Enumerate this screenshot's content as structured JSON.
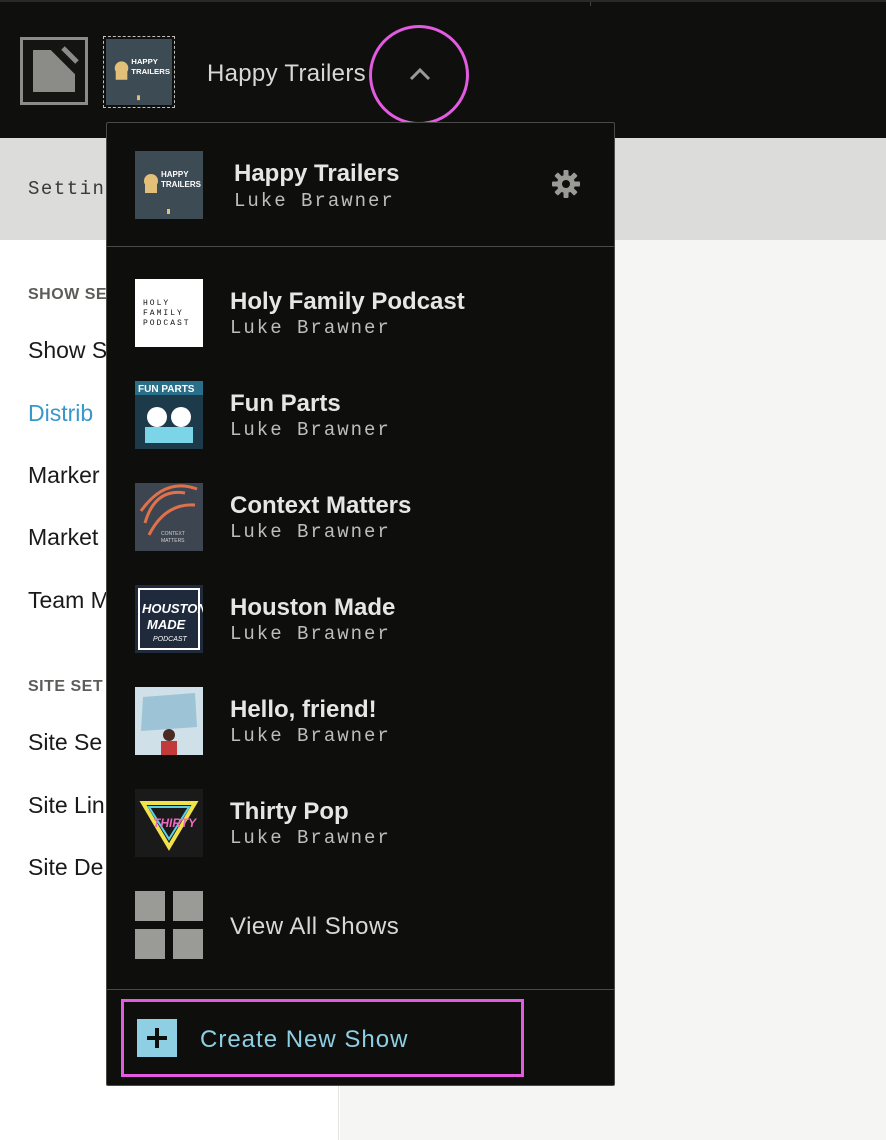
{
  "header": {
    "current_show_title": "Happy Trailers",
    "chevron_icon": "chevron-up-icon",
    "logo_icon": "app-logo-icon"
  },
  "subbar": {
    "label": "Settin"
  },
  "leftnav": {
    "section_show": "SHOW SE",
    "show_items": [
      {
        "label": "Show S",
        "active": false
      },
      {
        "label": "Distrib",
        "active": true
      },
      {
        "label": "Marker",
        "active": false
      },
      {
        "label": "Market",
        "active": false
      },
      {
        "label": "Team M",
        "active": false
      }
    ],
    "section_site": "SITE SET",
    "site_items": [
      {
        "label": "Site Se"
      },
      {
        "label": "Site Lin"
      },
      {
        "label": "Site De"
      }
    ]
  },
  "dropdown": {
    "current": {
      "title": "Happy Trailers",
      "author": "Luke Brawner",
      "thumb_text": "HAPPY TRAILERS",
      "settings_icon": "gear-icon"
    },
    "shows": [
      {
        "title": "Holy Family Podcast",
        "author": "Luke Brawner",
        "thumb_text": "HOLY FAMILY PODCAST"
      },
      {
        "title": "Fun Parts",
        "author": "Luke Brawner",
        "thumb_text": "FUN PARTS"
      },
      {
        "title": "Context Matters",
        "author": "Luke Brawner",
        "thumb_text": "CONTEXT MATTERS"
      },
      {
        "title": "Houston Made",
        "author": "Luke Brawner",
        "thumb_text": "HOUSTON MADE"
      },
      {
        "title": "Hello, friend!",
        "author": "Luke Brawner",
        "thumb_text": ""
      },
      {
        "title": "Thirty Pop",
        "author": "Luke Brawner",
        "thumb_text": "THIRTY POP"
      }
    ],
    "view_all_label": "View All Shows",
    "view_all_icon": "grid-icon",
    "create_label": "Create New Show",
    "create_icon": "plus-icon"
  },
  "colors": {
    "topbar_bg": "#0f0f0d",
    "dropdown_bg": "#0e0e0c",
    "accent_link": "#3a97c9",
    "create_accent": "#8ecfe3",
    "highlight": "#e25be0"
  }
}
